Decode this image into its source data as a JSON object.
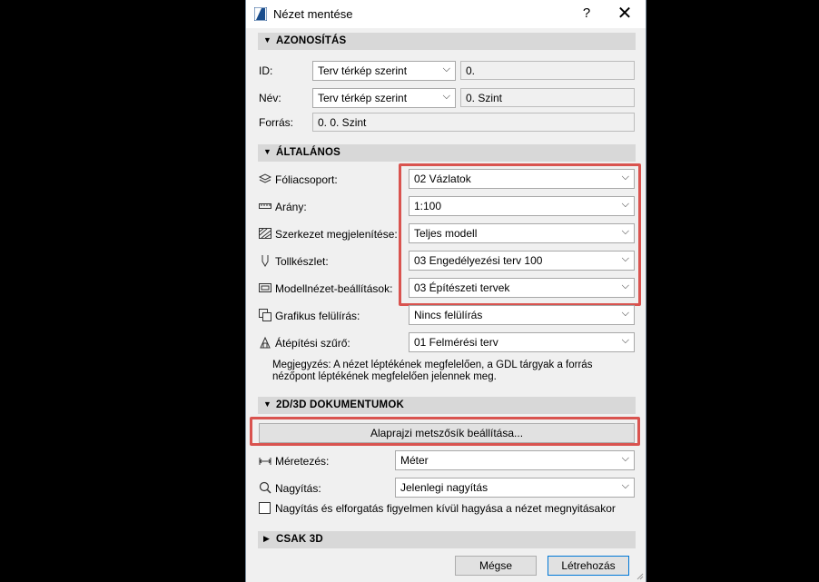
{
  "window": {
    "title": "Nézet mentése",
    "help": "?",
    "close": "✕"
  },
  "sections": {
    "azonositas": "AZONOSÍTÁS",
    "altalanos": "ÁLTALÁNOS",
    "dokumentumok": "2D/3D DOKUMENTUMOK",
    "csak3d": "CSAK 3D"
  },
  "identification": {
    "id_label": "ID:",
    "id_select": "Terv térkép szerint",
    "id_value": "0.",
    "name_label": "Név:",
    "name_select": "Terv térkép szerint",
    "name_value": "0. Szint",
    "source_label": "Forrás:",
    "source_value": "0. 0. Szint"
  },
  "general": {
    "layer_label": "Fóliacsoport:",
    "layer_value": "02 Vázlatok",
    "scale_label": "Arány:",
    "scale_value": "1:100",
    "structure_label": "Szerkezet megjelenítése:",
    "structure_value": "Teljes modell",
    "pen_label": "Tollkészlet:",
    "pen_value": "03 Engedélyezési terv 100",
    "mvo_label": "Modellnézet-beállítások:",
    "mvo_value": "03 Építészeti tervek",
    "graphic_label": "Grafikus felülírás:",
    "graphic_value": "Nincs felülírás",
    "reno_label": "Átépítési szűrő:",
    "reno_value": "01 Felmérési terv",
    "note": "Megjegyzés: A nézet léptékének megfelelően, a GDL tárgyak a forrás nézőpont léptékének megfelelően jelennek meg."
  },
  "documents": {
    "plan_cut_button": "Alaprajzi metszősík beállítása...",
    "dim_label": "Méretezés:",
    "dim_value": "Méter",
    "zoom_label": "Nagyítás:",
    "zoom_value": "Jelenlegi nagyítás",
    "ignore_label": "Nagyítás és elforgatás figyelmen kívül hagyása a nézet megnyitásakor"
  },
  "footer": {
    "cancel": "Mégse",
    "create": "Létrehozás"
  },
  "colors": {
    "highlight": "#d9534f",
    "accent": "#0078d7"
  }
}
